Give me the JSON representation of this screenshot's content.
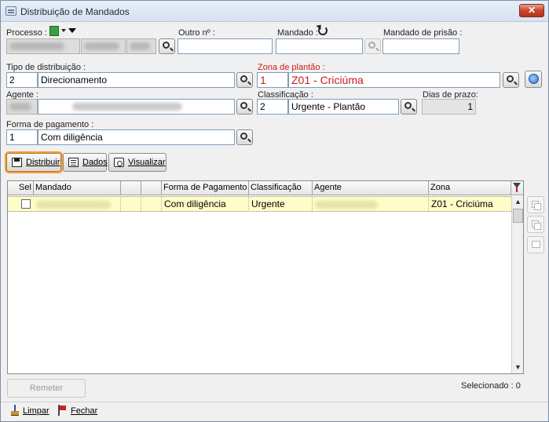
{
  "window": {
    "title": "Distribuição de Mandados",
    "close_label": "✕"
  },
  "processo": {
    "label": "Processo :"
  },
  "outro": {
    "label": "Outro nº :",
    "value": ""
  },
  "mandado": {
    "label": "Mandado :"
  },
  "mandado_prisao": {
    "label": "Mandado de prisão :",
    "value": ""
  },
  "tipo_distribuicao": {
    "label": "Tipo de distribuição :",
    "code": "2",
    "value": "Direcionamento"
  },
  "zona_plantao": {
    "label": "Zona de plantão :",
    "code": "1",
    "value": "Z01 - Criciúma"
  },
  "agente": {
    "label": "Agente :"
  },
  "classificacao": {
    "label": "Classificação :",
    "code": "2",
    "value": "Urgente - Plantão"
  },
  "dias_prazo": {
    "label": "Dias de prazo:",
    "value": "1"
  },
  "forma_pagamento": {
    "label": "Forma de pagamento :",
    "code": "1",
    "value": "Com diligência"
  },
  "toolbar": {
    "distribuir": "Distribuir",
    "dados": "Dados",
    "visualizar": "Visualizar"
  },
  "grid": {
    "columns": [
      "Sel",
      "Mandado",
      "",
      "",
      "Forma de Pagamento",
      "Classificação",
      "Agente",
      "Zona"
    ],
    "rows": [
      {
        "forma": "Com diligência",
        "classificacao": "Urgente",
        "zona": "Z01 - Criciúma"
      }
    ]
  },
  "remeter": "Remeter",
  "selecionado": "Selecionado : 0",
  "footer": {
    "limpar": "Limpar",
    "fechar": "Fechar"
  }
}
